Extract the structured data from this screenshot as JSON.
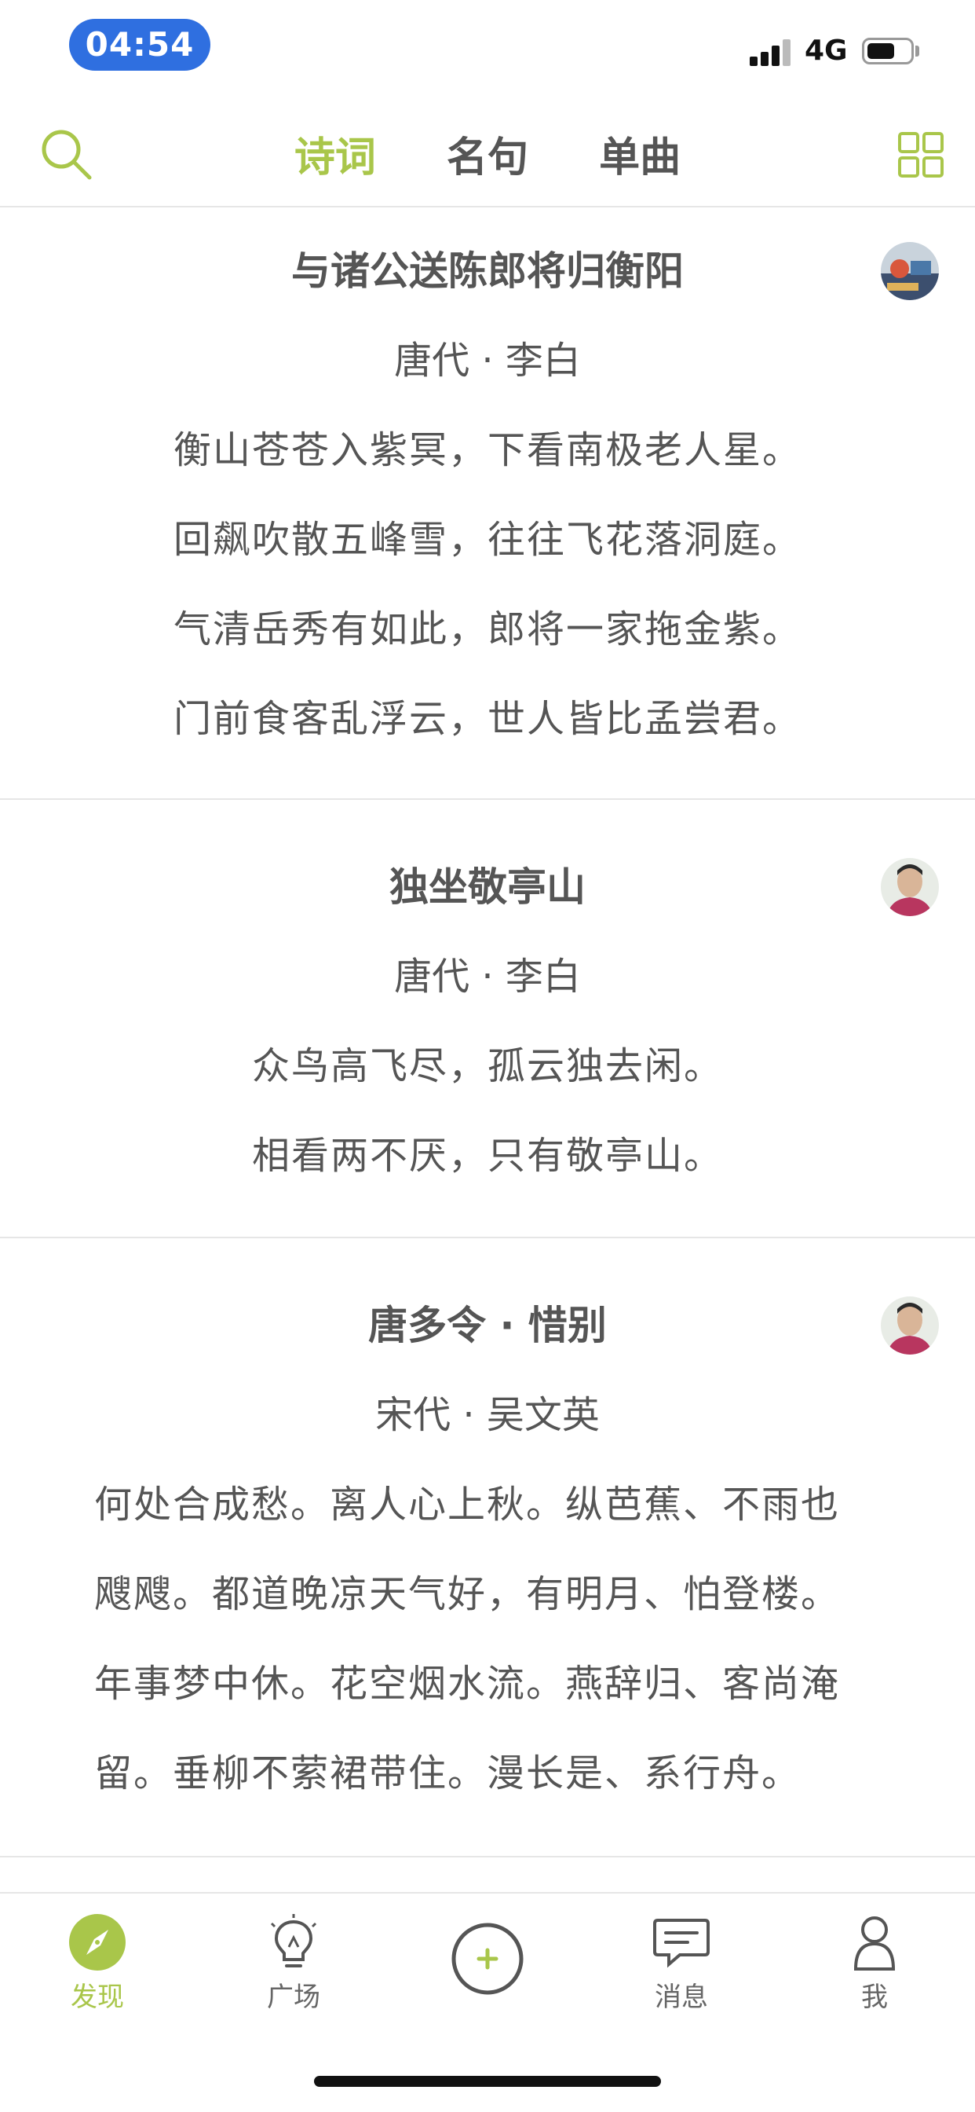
{
  "status_bar": {
    "time": "04:54",
    "network": "4G"
  },
  "header": {
    "tabs": [
      {
        "label": "诗词",
        "active": true
      },
      {
        "label": "名句",
        "active": false
      },
      {
        "label": "单曲",
        "active": false
      }
    ]
  },
  "poems": [
    {
      "title": "与诸公送陈郎将归衡阳",
      "author": "唐代 · 李白",
      "lines": [
        "衡山苍苍入紫冥，下看南极老人星。",
        "回飙吹散五峰雪，往往飞花落洞庭。",
        "气清岳秀有如此，郎将一家拖金紫。",
        "门前食客乱浮云，世人皆比孟尝君。"
      ]
    },
    {
      "title": "独坐敬亭山",
      "author": "唐代 · 李白",
      "lines": [
        "众鸟高飞尽，孤云独去闲。",
        "相看两不厌，只有敬亭山。"
      ]
    },
    {
      "title": "唐多令 · 惜别",
      "author": "宋代 · 吴文英",
      "lines": [
        "何处合成愁。离人心上秋。纵芭蕉、不雨也",
        "飕飕。都道晚凉天气好，有明月、怕登楼。",
        "年事梦中休。花空烟水流。燕辞归、客尚淹",
        "留。垂柳不萦裙带住。漫长是、系行舟。"
      ]
    }
  ],
  "bottom_nav": {
    "items": [
      {
        "label": "发现",
        "icon": "compass-icon",
        "active": true
      },
      {
        "label": "广场",
        "icon": "lightbulb-icon",
        "active": false
      },
      {
        "label": "",
        "icon": "plus-circle-icon",
        "active": false
      },
      {
        "label": "消息",
        "icon": "chat-bubble-icon",
        "active": false
      },
      {
        "label": "我",
        "icon": "person-icon",
        "active": false
      }
    ]
  },
  "colors": {
    "accent": "#a9c64a",
    "text": "#555555",
    "divider": "#e6e6e6",
    "time_pill": "#2f6fe0"
  }
}
